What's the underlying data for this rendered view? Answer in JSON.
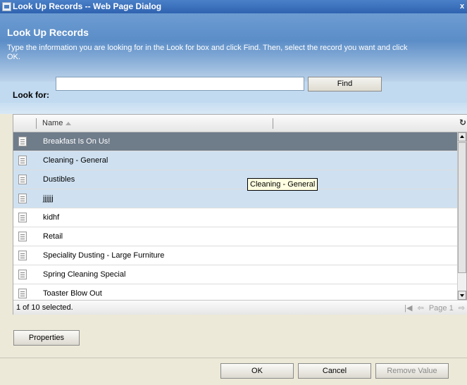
{
  "window": {
    "title": "Look Up Records -- Web Page Dialog",
    "close_glyph": "x"
  },
  "header": {
    "title": "Look Up Records",
    "description_line1": "Type the information you are looking for in the Look for box and click Find. Then, select the record you want and click",
    "description_line2": "OK."
  },
  "search": {
    "label": "Look for:",
    "value": "",
    "find_label": "Find"
  },
  "grid": {
    "columns": [
      "Name"
    ],
    "refresh_glyph": "↻",
    "rows": [
      {
        "name": "Breakfast Is On Us!",
        "selected": true
      },
      {
        "name": "Cleaning - General",
        "selected": false
      },
      {
        "name": "Dustibles",
        "selected": false
      },
      {
        "name": "jjjjjj",
        "selected": false
      },
      {
        "name": "kidhf",
        "selected": false
      },
      {
        "name": "Retail",
        "selected": false
      },
      {
        "name": "Speciality Dusting - Large Furniture",
        "selected": false
      },
      {
        "name": "Spring Cleaning Special",
        "selected": false
      },
      {
        "name": "Toaster Blow Out",
        "selected": false
      }
    ],
    "status": "1 of 10 selected.",
    "pager": {
      "first_glyph": "|◀",
      "prev_glyph": "⇦",
      "page_label": "Page 1",
      "next_glyph": "⇨"
    },
    "tooltip": "Cleaning - General"
  },
  "buttons": {
    "properties": "Properties",
    "ok": "OK",
    "cancel": "Cancel",
    "remove": "Remove Value"
  },
  "colors": {
    "header_blue": "#5b8dc7",
    "selected_row": "#6f7c8a",
    "band": "#cfe1f1"
  }
}
